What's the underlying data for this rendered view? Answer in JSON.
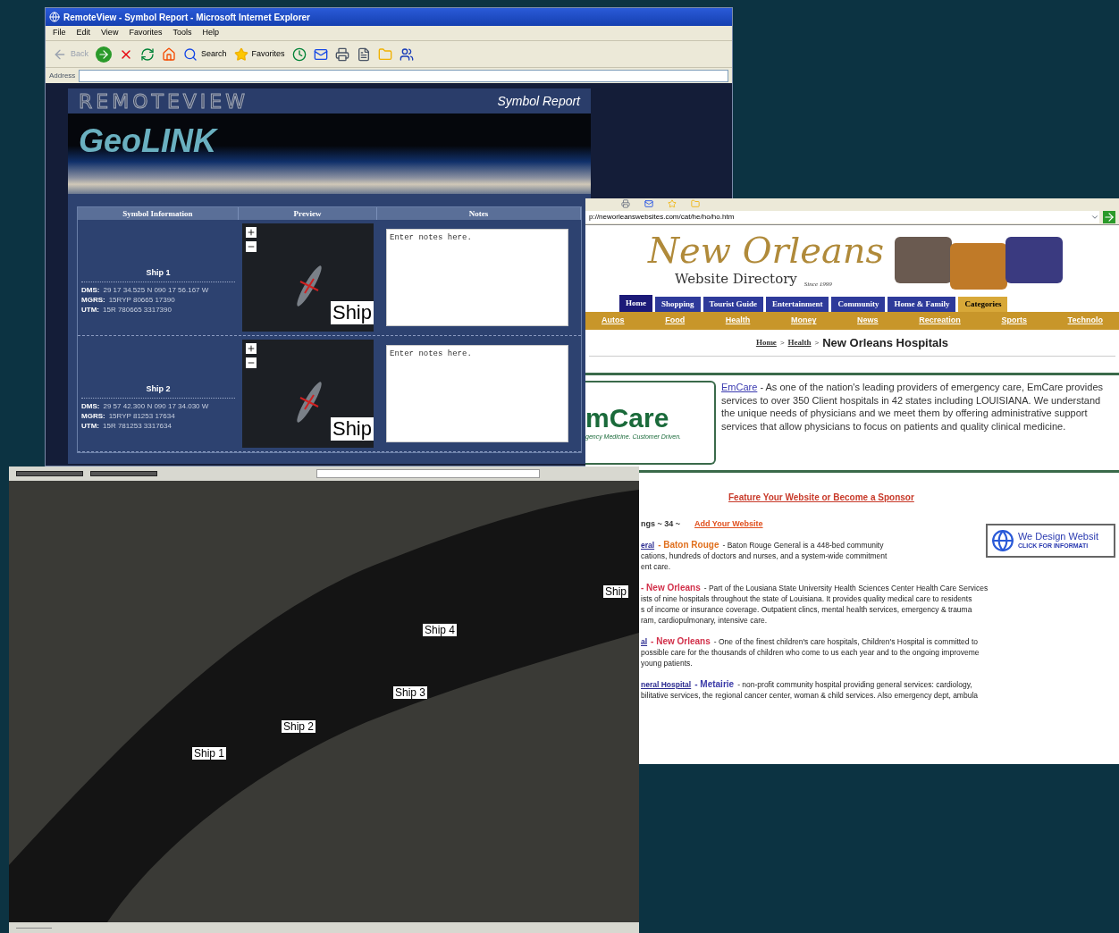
{
  "symbol_report_window": {
    "title": "RemoteView - Symbol Report - Microsoft Internet Explorer",
    "menu": [
      "File",
      "Edit",
      "View",
      "Favorites",
      "Tools",
      "Help"
    ],
    "toolbar": {
      "back": "Back",
      "search": "Search",
      "favorites": "Favorites"
    },
    "address_label": "Address",
    "app_name": "REMOTEVIEW",
    "page_title": "Symbol Report",
    "logo": "GeoLINK",
    "columns": [
      "Symbol Information",
      "Preview",
      "Notes"
    ],
    "rows": [
      {
        "name": "Ship 1",
        "dms_label": "DMS:",
        "dms": "29 17 34.525 N 090 17 56.167 W",
        "mgrs_label": "MGRS:",
        "mgrs": "15RYP 80665 17390",
        "utm_label": "UTM:",
        "utm": "15R 780665 3317390",
        "preview_label": "Ship",
        "notes_placeholder": "Enter notes here."
      },
      {
        "name": "Ship 2",
        "dms_label": "DMS:",
        "dms": "29 57 42.300 N 090 17 34.030 W",
        "mgrs_label": "MGRS:",
        "mgrs": "15RYP 81253 17634",
        "utm_label": "UTM:",
        "utm": "15R 781253 3317634",
        "preview_label": "Ship",
        "notes_placeholder": "Enter notes here."
      }
    ]
  },
  "directory_window": {
    "url": "p://neworleanswebsites.com/cat/he/ho/ho.htm",
    "logo_title": "New Orleans",
    "logo_subtitle": "Website Directory",
    "logo_since": "Since 1999",
    "nav": [
      {
        "label": "Home",
        "selected": true,
        "kind": "section"
      },
      {
        "label": "Shopping",
        "selected": false,
        "kind": "section"
      },
      {
        "label": "Tourist Guide",
        "selected": false,
        "kind": "section"
      },
      {
        "label": "Entertainment",
        "selected": false,
        "kind": "section"
      },
      {
        "label": "Community",
        "selected": false,
        "kind": "section"
      },
      {
        "label": "Home & Family",
        "selected": false,
        "kind": "section"
      },
      {
        "label": "Categories",
        "selected": false,
        "kind": "categories"
      }
    ],
    "subnav": [
      "Autos",
      "Food",
      "Health",
      "Money",
      "News",
      "Recreation",
      "Sports",
      "Technolo"
    ],
    "breadcrumb": {
      "links": [
        "Home",
        "Health"
      ],
      "separator": ">",
      "current": "New Orleans Hospitals"
    },
    "sponsor": {
      "logo": "mCare",
      "tagline": "gency Medicine. Customer Driven.",
      "link": "EmCare",
      "text": "- As one of the nation's leading providers of emergency care, EmCare provides services to over 350 Client hospitals in 42 states including LOUISIANA.  We understand the unique needs of physicians and we meet them by offering administrative support services that allow physicians to focus on patients and quality clinical medicine."
    },
    "feature_link": "Feature Your Website or Become a Sponsor",
    "listings_count": "ngs ~ 34 ~",
    "add_link": "Add Your Website",
    "ad": {
      "title": "We Design Websit",
      "subtitle": "CLICK FOR INFORMATI"
    },
    "listings": [
      {
        "name": "eral",
        "city": "- Baton Rouge",
        "color": "#e0701e",
        "lines": [
          "- Baton Rouge General is a 448-bed community",
          "cations, hundreds of doctors and nurses, and a system-wide commitment",
          "ent care."
        ]
      },
      {
        "city": "- New Orleans",
        "color": "#d2304a",
        "lines": [
          "- Part of the Lousiana State University Health Sciences Center Health Care Services",
          "ists of nine hospitals throughout the state of Louisiana. It provides quality medical care to residents",
          "s of income or insurance coverage.  Outpatient clincs, mental health services, emergency & trauma",
          "ram, cardiopulmonary, intensive care."
        ]
      },
      {
        "name": "al",
        "city": "- New Orleans",
        "color": "#d2304a",
        "lines": [
          "- One of the finest children's care hospitals, Children's Hospital is committed to",
          "possible care for the thousands of children who come to us each year and to the ongoing improveme",
          "young patients."
        ]
      },
      {
        "name": "neral Hospital",
        "city": "- Metairie",
        "color": "#3a3aa8",
        "lines": [
          "- non-profit community hospital providing general services: cardiology,",
          "bilitative services, the regional cancer center, woman & child services. Also emergency dept, ambula"
        ]
      }
    ]
  },
  "map_window": {
    "sliders": [
      {
        "level": 1
      },
      {
        "level": 1
      }
    ],
    "labels": [
      {
        "text": "Ship 1"
      },
      {
        "text": "Ship 2"
      },
      {
        "text": "Ship 3"
      },
      {
        "text": "Ship 4"
      },
      {
        "text": "Ship"
      }
    ]
  }
}
